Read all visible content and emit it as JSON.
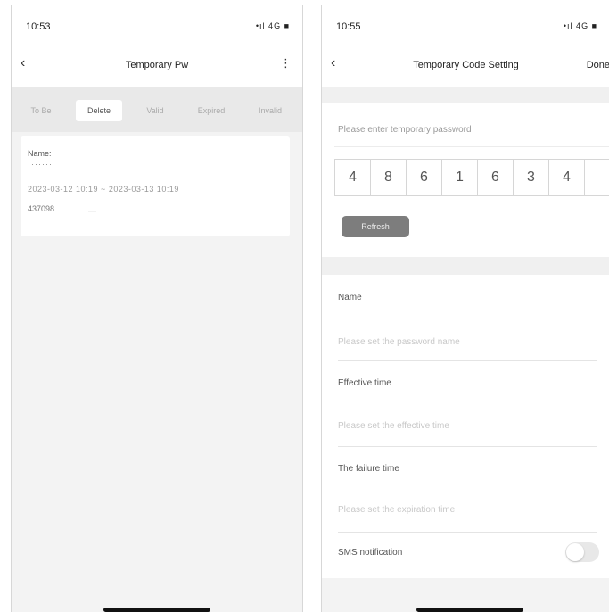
{
  "left_screen": {
    "status": {
      "time": "10:53",
      "icons": "•ıl 4G ■"
    },
    "nav": {
      "back": "‹",
      "title": "Temporary Pw",
      "more": "⋮"
    },
    "tabs": [
      "To Be",
      "Delete",
      "Valid",
      "Expired",
      "Invalid"
    ],
    "active_tab": "Delete",
    "card": {
      "name_label": "Name:",
      "name_value": "·······",
      "period": "2023-03-12 10:19 ~ 2023-03-13 10:19",
      "code_label": "437098",
      "code_value": "—"
    }
  },
  "right_screen": {
    "status": {
      "time": "10:55",
      "icons": "•ıl 4G ■"
    },
    "nav": {
      "back": "‹",
      "title": "Temporary Code Setting",
      "done": "Done"
    },
    "password": {
      "label": "Please enter temporary password",
      "digits": [
        "4",
        "8",
        "6",
        "1",
        "6",
        "3",
        "4"
      ],
      "refresh": "Refresh"
    },
    "form": {
      "name_label": "Name",
      "name_placeholder": "Please set the password name",
      "effective_label": "Effective time",
      "effective_placeholder": "Please set the effective time",
      "expire_label": "The failure time",
      "expire_placeholder": "Please set the expiration time",
      "notify_label": "SMS notification"
    },
    "toggle": {
      "on": false
    }
  }
}
